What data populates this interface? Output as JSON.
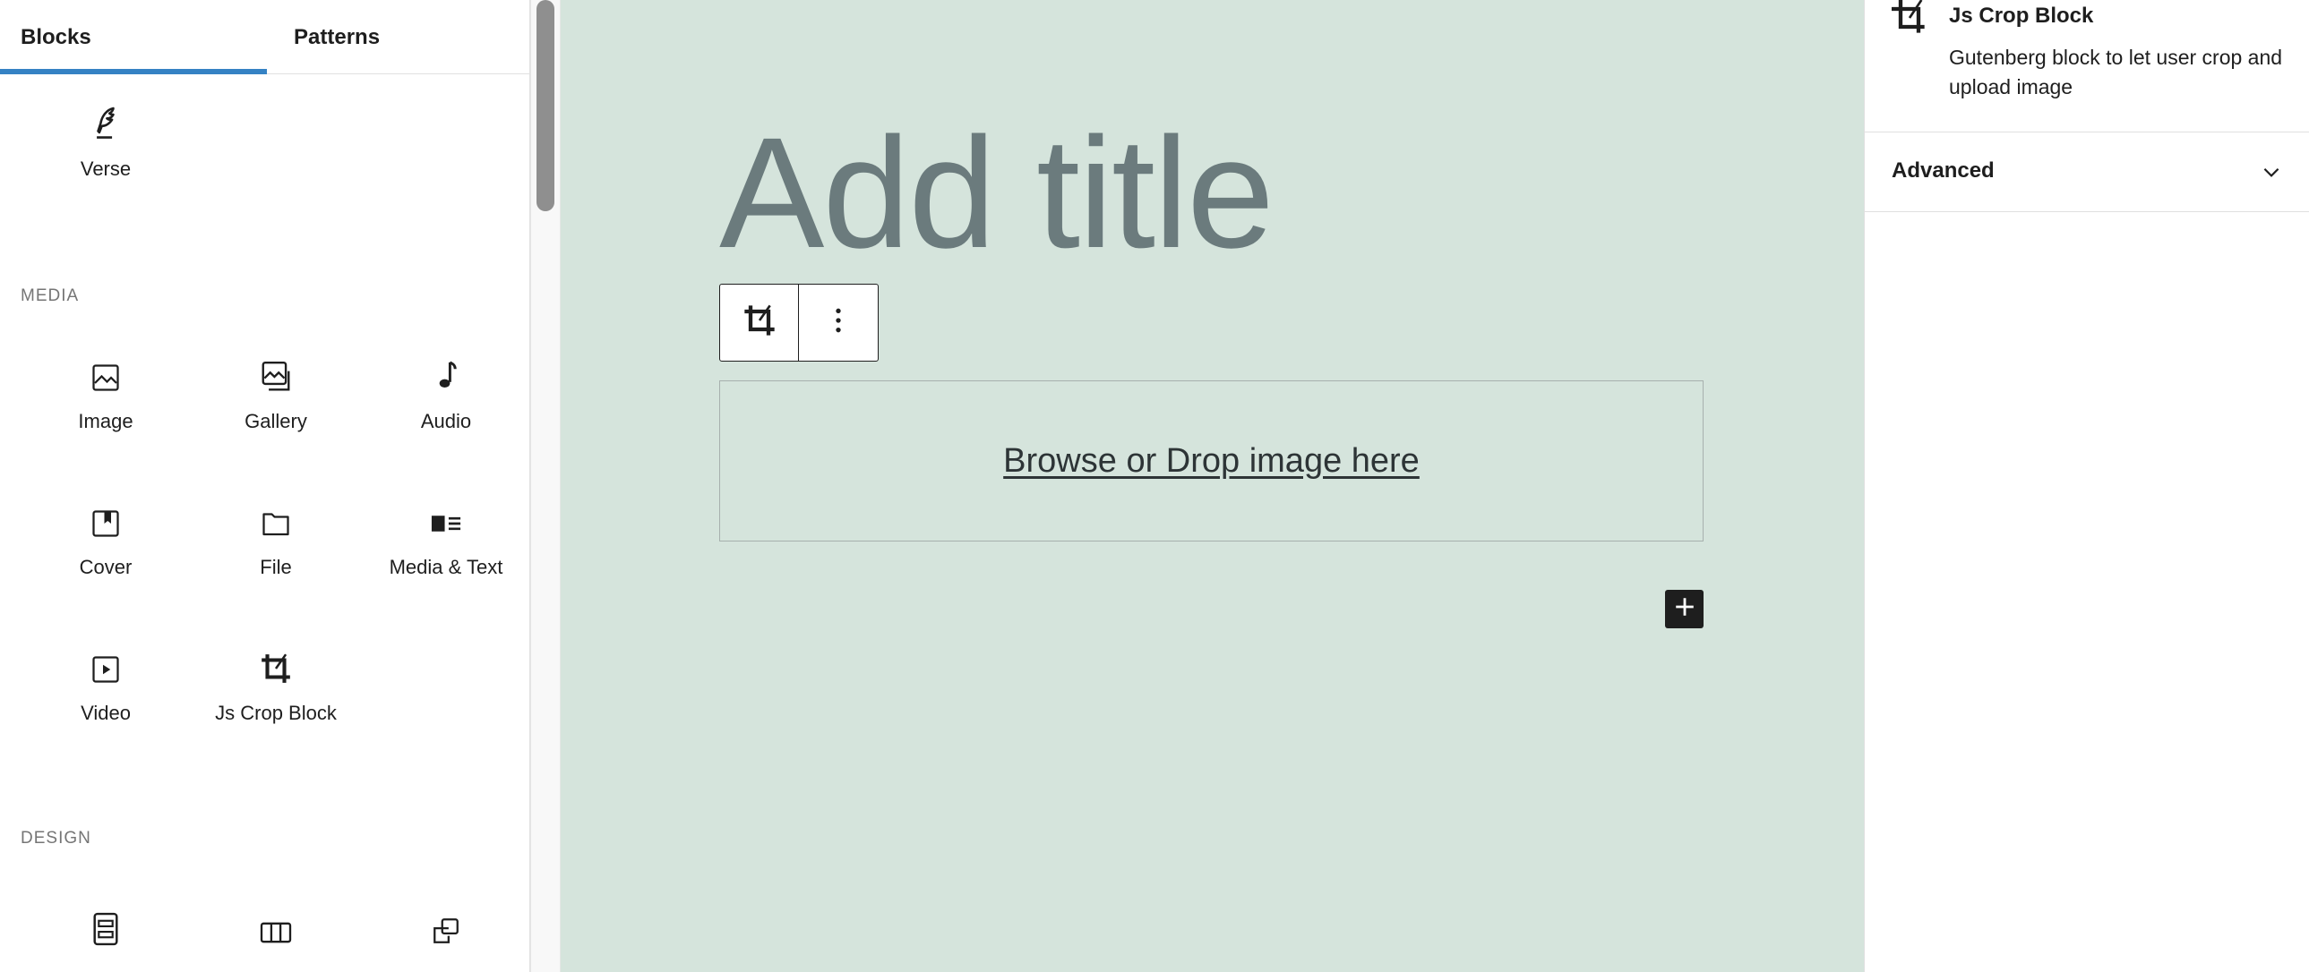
{
  "inserter": {
    "tabs": [
      {
        "label": "Blocks",
        "active": true
      },
      {
        "label": "Patterns",
        "active": false
      }
    ],
    "text_blocks": [
      {
        "label": "Verse",
        "icon": "verse-icon"
      }
    ],
    "media": {
      "title": "MEDIA",
      "items": [
        {
          "label": "Image",
          "icon": "image-icon"
        },
        {
          "label": "Gallery",
          "icon": "gallery-icon"
        },
        {
          "label": "Audio",
          "icon": "audio-icon"
        },
        {
          "label": "Cover",
          "icon": "cover-icon"
        },
        {
          "label": "File",
          "icon": "file-icon"
        },
        {
          "label": "Media & Text",
          "icon": "media-text-icon"
        },
        {
          "label": "Video",
          "icon": "video-icon"
        },
        {
          "label": "Js Crop Block",
          "icon": "crop-icon"
        }
      ]
    },
    "design": {
      "title": "DESIGN",
      "items": [
        {
          "label": "",
          "icon": "group-icon"
        },
        {
          "label": "",
          "icon": "columns-icon"
        },
        {
          "label": "",
          "icon": "reusable-icon"
        }
      ]
    }
  },
  "canvas": {
    "title_placeholder": "Add title",
    "dropzone_text": "Browse or Drop image here",
    "background": "#d5e4dc"
  },
  "sidebar": {
    "block_name": "Js Crop Block",
    "block_description": "Gutenberg block to let user crop and upload image",
    "advanced_label": "Advanced"
  },
  "colors": {
    "accent": "#3582c4",
    "dark": "#1e1e1e"
  }
}
